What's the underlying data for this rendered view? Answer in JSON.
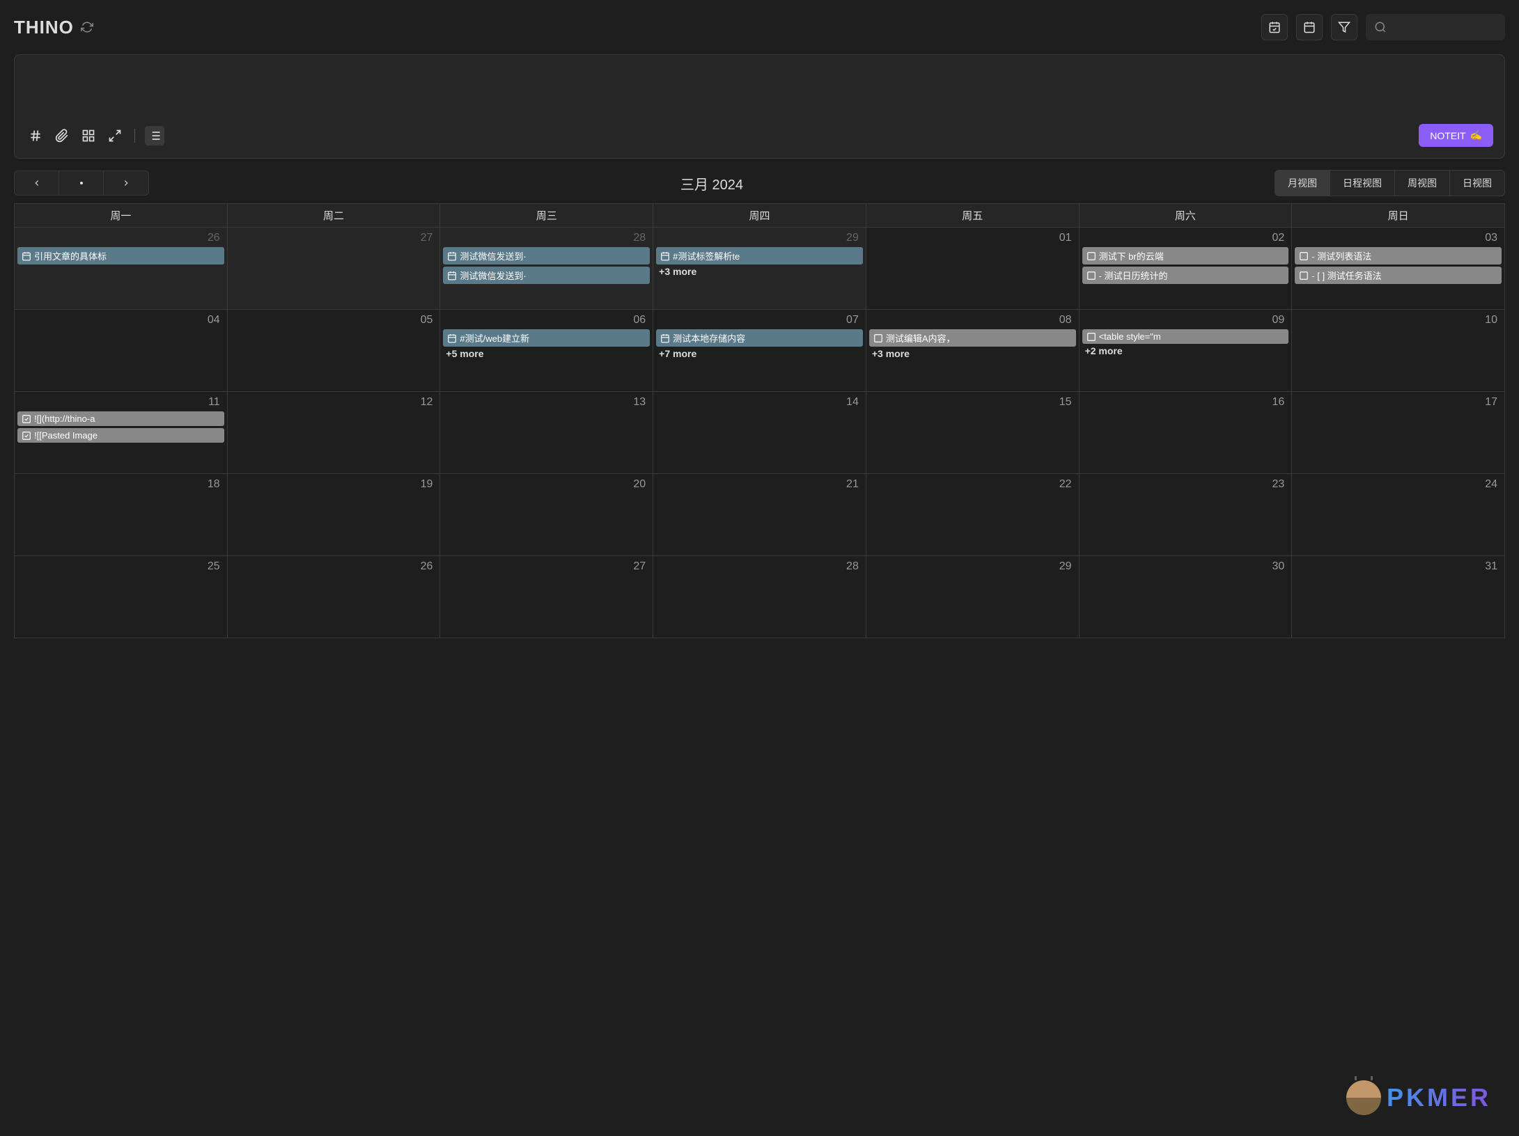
{
  "app": {
    "title": "THINO"
  },
  "noteit": {
    "label": "NOTEIT"
  },
  "calendar": {
    "title": "三月 2024",
    "views": [
      "月视图",
      "日程视图",
      "周视图",
      "日视图"
    ],
    "activeView": 0,
    "dayHeaders": [
      "周一",
      "周二",
      "周三",
      "周四",
      "周五",
      "周六",
      "周日"
    ]
  },
  "weeks": [
    [
      {
        "num": "26",
        "other": true,
        "events": [
          {
            "type": "journal",
            "text": "引用文章的具体标"
          }
        ]
      },
      {
        "num": "27",
        "other": true,
        "events": []
      },
      {
        "num": "28",
        "other": true,
        "events": [
          {
            "type": "journal",
            "text": "测试微信发送到·"
          },
          {
            "type": "journal",
            "text": "测试微信发送到·"
          }
        ]
      },
      {
        "num": "29",
        "other": true,
        "events": [
          {
            "type": "journal",
            "text": "#测试标签解析te"
          }
        ],
        "more": "+3 more"
      },
      {
        "num": "01",
        "events": []
      },
      {
        "num": "02",
        "events": [
          {
            "type": "task",
            "text": "测试下 br的云端"
          },
          {
            "type": "task",
            "text": "- 测试日历统计的"
          }
        ]
      },
      {
        "num": "03",
        "events": [
          {
            "type": "task",
            "text": "- 测试列表语法"
          },
          {
            "type": "task",
            "text": "- [ ] 测试任务语法"
          }
        ]
      }
    ],
    [
      {
        "num": "04",
        "events": []
      },
      {
        "num": "05",
        "events": []
      },
      {
        "num": "06",
        "events": [
          {
            "type": "journal",
            "text": "#测试/web建立新"
          }
        ],
        "more": "+5 more"
      },
      {
        "num": "07",
        "events": [
          {
            "type": "journal",
            "text": "测试本地存储内容"
          }
        ],
        "more": "+7 more"
      },
      {
        "num": "08",
        "events": [
          {
            "type": "task",
            "text": "测试编辑A内容，"
          }
        ],
        "more": "+3 more"
      },
      {
        "num": "09",
        "events": [
          {
            "type": "task",
            "text": "<table style=\"m"
          }
        ],
        "more": "+2 more"
      },
      {
        "num": "10",
        "events": []
      }
    ],
    [
      {
        "num": "11",
        "events": [
          {
            "type": "done",
            "text": "![](http://thino-a"
          },
          {
            "type": "done",
            "text": "![[Pasted Image"
          }
        ]
      },
      {
        "num": "12",
        "events": []
      },
      {
        "num": "13",
        "events": []
      },
      {
        "num": "14",
        "events": []
      },
      {
        "num": "15",
        "events": []
      },
      {
        "num": "16",
        "events": []
      },
      {
        "num": "17",
        "events": []
      }
    ],
    [
      {
        "num": "18",
        "events": []
      },
      {
        "num": "19",
        "events": []
      },
      {
        "num": "20",
        "events": []
      },
      {
        "num": "21",
        "events": []
      },
      {
        "num": "22",
        "events": []
      },
      {
        "num": "23",
        "events": []
      },
      {
        "num": "24",
        "events": []
      }
    ],
    [
      {
        "num": "25",
        "events": []
      },
      {
        "num": "26",
        "events": []
      },
      {
        "num": "27",
        "events": []
      },
      {
        "num": "28",
        "events": []
      },
      {
        "num": "29",
        "events": []
      },
      {
        "num": "30",
        "events": []
      },
      {
        "num": "31",
        "events": []
      }
    ]
  ],
  "watermark": {
    "text": "PKMER"
  }
}
